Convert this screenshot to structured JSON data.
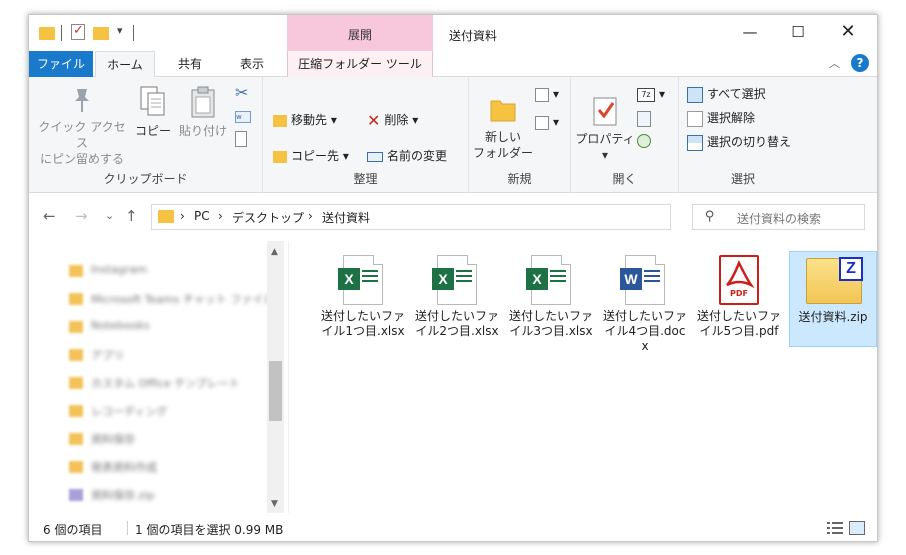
{
  "window": {
    "title": "送付資料",
    "context_tab_header": "展開",
    "controls": {
      "minimize": "—",
      "maximize": "☐",
      "close": "✕"
    }
  },
  "ribbon_tabs": {
    "file": "ファイル",
    "home": "ホーム",
    "share": "共有",
    "view": "表示",
    "compressed_tools": "圧縮フォルダー ツール"
  },
  "ribbon": {
    "clipboard": {
      "label": "クリップボード",
      "pin_line1": "クイック アクセス",
      "pin_line2": "にピン留めする",
      "copy": "コピー",
      "paste": "貼り付け"
    },
    "organize": {
      "label": "整理",
      "move_to": "移動先",
      "copy_to": "コピー先",
      "delete": "削除",
      "rename": "名前の変更"
    },
    "new": {
      "label": "新規",
      "new_folder_line1": "新しい",
      "new_folder_line2": "フォルダー"
    },
    "open": {
      "label": "開く",
      "properties": "プロパティ"
    },
    "select": {
      "label": "選択",
      "select_all": "すべて選択",
      "select_none": "選択解除",
      "invert": "選択の切り替え"
    }
  },
  "address": {
    "crumbs": [
      "PC",
      "デスクトップ",
      "送付資料"
    ],
    "separator": "›"
  },
  "search": {
    "placeholder": "送付資料の検索"
  },
  "nav_pane": {
    "items": [
      "Instagram",
      "Microsoft Teams チャット ファイル",
      "Notebooks",
      "アプリ",
      "カスタム Office テンプレート",
      "レコーディング",
      "資料保存",
      "発表資料作成",
      "資料保存.zip"
    ]
  },
  "files": [
    {
      "name": "送付したいファイル1つ目.xlsx",
      "type": "xlsx"
    },
    {
      "name": "送付したいファイル2つ目.xlsx",
      "type": "xlsx"
    },
    {
      "name": "送付したいファイル3つ目.xlsx",
      "type": "xlsx"
    },
    {
      "name": "送付したいファイル4つ目.docx",
      "type": "docx"
    },
    {
      "name": "送付したいファイル5つ目.pdf",
      "type": "pdf"
    },
    {
      "name": "送付資料.zip",
      "type": "zip",
      "selected": true
    }
  ],
  "file_badges": {
    "excel": "X",
    "word": "W",
    "pdf": "PDF",
    "zip": "Z"
  },
  "status": {
    "count": "6 個の項目",
    "selection": "1 個の項目を選択  0.99 MB"
  },
  "colors": {
    "accent": "#1979ca",
    "excel": "#1e7145",
    "word": "#2b579a",
    "pdf": "#cc1f1a",
    "context_tab": "#f7c8dc"
  }
}
